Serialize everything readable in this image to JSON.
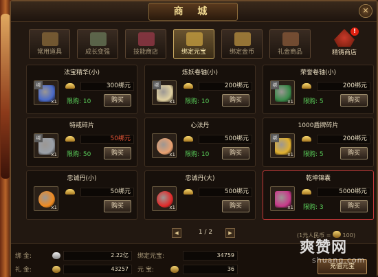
{
  "window": {
    "title": "商  城",
    "close_glyph": "✕"
  },
  "tabs": [
    {
      "label": "常用道具",
      "icon": "items-icon",
      "color": "#8a6a3a"
    },
    {
      "label": "成长变强",
      "icon": "growth-icon",
      "color": "#6a7a5a"
    },
    {
      "label": "技能商店",
      "icon": "skill-book-icon",
      "color": "#9a3a4a"
    },
    {
      "label": "绑定元宝",
      "icon": "bound-ingot-icon",
      "color": "#c8a040",
      "active": true
    },
    {
      "label": "绑定金币",
      "icon": "bound-coin-icon",
      "color": "#b89040"
    },
    {
      "label": "礼金商品",
      "icon": "gift-icon",
      "color": "#8a5a3a"
    },
    {
      "label": "精铸商店",
      "icon": "forge-shop-icon",
      "badge": "!"
    }
  ],
  "items": [
    {
      "name": "法宝精华(小)",
      "price": "300绑元",
      "limit": "限购: 10",
      "buy": "购买",
      "bound": "绑",
      "qty": "x1",
      "art": "crystal-icon",
      "art_color": "#4a6ac8",
      "price_red": false
    },
    {
      "name": "炼妖卷轴(小)",
      "price": "200绑元",
      "limit": "限购: 10",
      "buy": "购买",
      "bound": "绑",
      "qty": "x1",
      "art": "scroll-icon",
      "art_color": "#e0d0a0",
      "price_red": false
    },
    {
      "name": "荣誉卷轴(小)",
      "price": "200绑元",
      "limit": "限购: 5",
      "buy": "购买",
      "bound": "绑",
      "qty": "x1",
      "art": "green-scroll-icon",
      "art_color": "#3a8a4a",
      "price_red": false
    },
    {
      "name": "特戒碎片",
      "price": "50绑元",
      "limit": "限购: 50",
      "buy": "购买",
      "bound": "绑",
      "qty": "x1",
      "art": "ring-shard-icon",
      "art_color": "#9aa0a8",
      "price_red": true
    },
    {
      "name": "心法丹",
      "price": "500绑元",
      "limit": "限购: 10",
      "buy": "购买",
      "bound": "",
      "qty": "x1",
      "art": "buddha-pill-icon",
      "art_color": "#e8a070",
      "price_red": false
    },
    {
      "name": "1000盾牌碎片",
      "price": "200绑元",
      "limit": "限购: 5",
      "buy": "购买",
      "bound": "绑",
      "qty": "x1",
      "art": "shield-shard-icon",
      "art_color": "#e0b030",
      "price_red": false
    },
    {
      "name": "忠诚丹(小)",
      "price": "50绑元",
      "limit": "",
      "buy": "购买",
      "bound": "",
      "qty": "x1",
      "art": "orange-heart-icon",
      "art_color": "#f08a20",
      "price_red": false
    },
    {
      "name": "忠诚丹(大)",
      "price": "500绑元",
      "limit": "",
      "buy": "购买",
      "bound": "",
      "qty": "x1",
      "art": "red-heart-icon",
      "art_color": "#e02a2a",
      "price_red": false
    },
    {
      "name": "乾坤锦囊",
      "price": "5000绑元",
      "limit": "限购: 3",
      "buy": "购买",
      "bound": "",
      "qty": "x1",
      "art": "pouch-icon",
      "art_color": "#c83a8a",
      "price_red": false,
      "selected": true
    }
  ],
  "pager": {
    "prev": "◀",
    "next": "▶",
    "text": "1 / 2"
  },
  "rate": "(1元人民币 = ",
  "rate_value": "100)",
  "footer": {
    "bound_gold_label": "绑    金:",
    "bound_gold_value": "2.22亿",
    "bound_ingot_label": "绑定元宝:",
    "bound_ingot_value": "34759",
    "gift_gold_label": "礼    金:",
    "gift_gold_value": "43257",
    "ingot_label": "元    宝:",
    "ingot_value": "36",
    "recharge_label": "充值元宝"
  },
  "watermark": {
    "logo": "爽赞网",
    "url": "shuanq.com"
  }
}
